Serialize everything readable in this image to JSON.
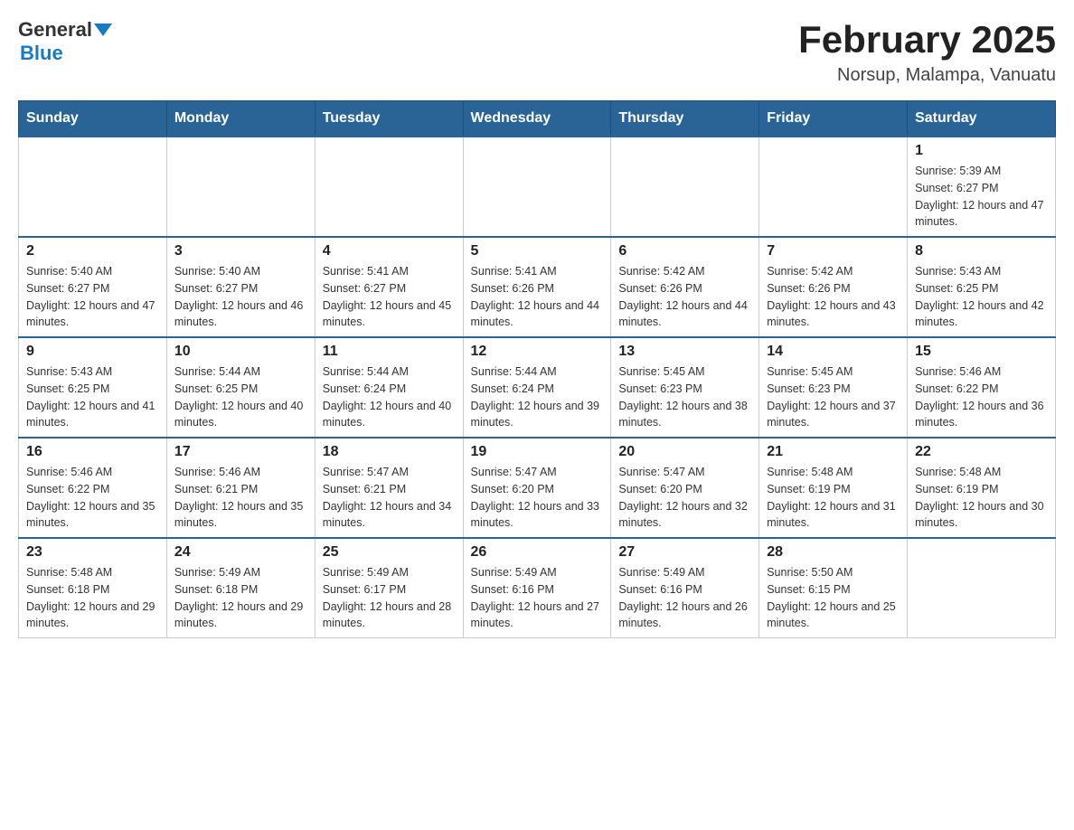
{
  "header": {
    "logo_general": "General",
    "logo_blue": "Blue",
    "title": "February 2025",
    "subtitle": "Norsup, Malampa, Vanuatu"
  },
  "days_of_week": [
    "Sunday",
    "Monday",
    "Tuesday",
    "Wednesday",
    "Thursday",
    "Friday",
    "Saturday"
  ],
  "weeks": [
    [
      {
        "day": "",
        "info": ""
      },
      {
        "day": "",
        "info": ""
      },
      {
        "day": "",
        "info": ""
      },
      {
        "day": "",
        "info": ""
      },
      {
        "day": "",
        "info": ""
      },
      {
        "day": "",
        "info": ""
      },
      {
        "day": "1",
        "info": "Sunrise: 5:39 AM\nSunset: 6:27 PM\nDaylight: 12 hours and 47 minutes."
      }
    ],
    [
      {
        "day": "2",
        "info": "Sunrise: 5:40 AM\nSunset: 6:27 PM\nDaylight: 12 hours and 47 minutes."
      },
      {
        "day": "3",
        "info": "Sunrise: 5:40 AM\nSunset: 6:27 PM\nDaylight: 12 hours and 46 minutes."
      },
      {
        "day": "4",
        "info": "Sunrise: 5:41 AM\nSunset: 6:27 PM\nDaylight: 12 hours and 45 minutes."
      },
      {
        "day": "5",
        "info": "Sunrise: 5:41 AM\nSunset: 6:26 PM\nDaylight: 12 hours and 44 minutes."
      },
      {
        "day": "6",
        "info": "Sunrise: 5:42 AM\nSunset: 6:26 PM\nDaylight: 12 hours and 44 minutes."
      },
      {
        "day": "7",
        "info": "Sunrise: 5:42 AM\nSunset: 6:26 PM\nDaylight: 12 hours and 43 minutes."
      },
      {
        "day": "8",
        "info": "Sunrise: 5:43 AM\nSunset: 6:25 PM\nDaylight: 12 hours and 42 minutes."
      }
    ],
    [
      {
        "day": "9",
        "info": "Sunrise: 5:43 AM\nSunset: 6:25 PM\nDaylight: 12 hours and 41 minutes."
      },
      {
        "day": "10",
        "info": "Sunrise: 5:44 AM\nSunset: 6:25 PM\nDaylight: 12 hours and 40 minutes."
      },
      {
        "day": "11",
        "info": "Sunrise: 5:44 AM\nSunset: 6:24 PM\nDaylight: 12 hours and 40 minutes."
      },
      {
        "day": "12",
        "info": "Sunrise: 5:44 AM\nSunset: 6:24 PM\nDaylight: 12 hours and 39 minutes."
      },
      {
        "day": "13",
        "info": "Sunrise: 5:45 AM\nSunset: 6:23 PM\nDaylight: 12 hours and 38 minutes."
      },
      {
        "day": "14",
        "info": "Sunrise: 5:45 AM\nSunset: 6:23 PM\nDaylight: 12 hours and 37 minutes."
      },
      {
        "day": "15",
        "info": "Sunrise: 5:46 AM\nSunset: 6:22 PM\nDaylight: 12 hours and 36 minutes."
      }
    ],
    [
      {
        "day": "16",
        "info": "Sunrise: 5:46 AM\nSunset: 6:22 PM\nDaylight: 12 hours and 35 minutes."
      },
      {
        "day": "17",
        "info": "Sunrise: 5:46 AM\nSunset: 6:21 PM\nDaylight: 12 hours and 35 minutes."
      },
      {
        "day": "18",
        "info": "Sunrise: 5:47 AM\nSunset: 6:21 PM\nDaylight: 12 hours and 34 minutes."
      },
      {
        "day": "19",
        "info": "Sunrise: 5:47 AM\nSunset: 6:20 PM\nDaylight: 12 hours and 33 minutes."
      },
      {
        "day": "20",
        "info": "Sunrise: 5:47 AM\nSunset: 6:20 PM\nDaylight: 12 hours and 32 minutes."
      },
      {
        "day": "21",
        "info": "Sunrise: 5:48 AM\nSunset: 6:19 PM\nDaylight: 12 hours and 31 minutes."
      },
      {
        "day": "22",
        "info": "Sunrise: 5:48 AM\nSunset: 6:19 PM\nDaylight: 12 hours and 30 minutes."
      }
    ],
    [
      {
        "day": "23",
        "info": "Sunrise: 5:48 AM\nSunset: 6:18 PM\nDaylight: 12 hours and 29 minutes."
      },
      {
        "day": "24",
        "info": "Sunrise: 5:49 AM\nSunset: 6:18 PM\nDaylight: 12 hours and 29 minutes."
      },
      {
        "day": "25",
        "info": "Sunrise: 5:49 AM\nSunset: 6:17 PM\nDaylight: 12 hours and 28 minutes."
      },
      {
        "day": "26",
        "info": "Sunrise: 5:49 AM\nSunset: 6:16 PM\nDaylight: 12 hours and 27 minutes."
      },
      {
        "day": "27",
        "info": "Sunrise: 5:49 AM\nSunset: 6:16 PM\nDaylight: 12 hours and 26 minutes."
      },
      {
        "day": "28",
        "info": "Sunrise: 5:50 AM\nSunset: 6:15 PM\nDaylight: 12 hours and 25 minutes."
      },
      {
        "day": "",
        "info": ""
      }
    ]
  ]
}
